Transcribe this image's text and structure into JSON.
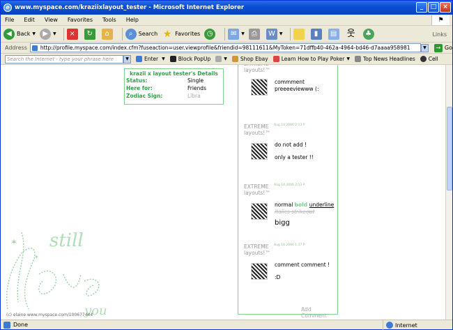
{
  "window": {
    "title": "www.myspace.com/kraziixlayout_tester - Microsoft Internet Explorer"
  },
  "menu": [
    "File",
    "Edit",
    "View",
    "Favorites",
    "Tools",
    "Help"
  ],
  "toolbar": {
    "back": "Back",
    "search": "Search",
    "favorites": "Favorites",
    "links": "Links"
  },
  "address": {
    "label": "Address",
    "url": "http://profile.myspace.com/index.cfm?fuseaction=user.viewprofile&friendid=98111611&MyToken=71dffb40-462a-4964-bd46-d7aaaa958981",
    "go": "Go"
  },
  "searchbar": {
    "placeholder": "Search the Internet - type your phrase here",
    "enter": "Enter",
    "block": "Block PopUp",
    "shop": "Shop Ebay",
    "poker": "Learn How to Play Poker",
    "news": "Top News Headlines",
    "cell": "Cell"
  },
  "details": {
    "heading": "krazii x layout tester's Details",
    "rows": [
      {
        "k": "Status:",
        "v": "Single"
      },
      {
        "k": "Here for:",
        "v": "Friends"
      },
      {
        "k": "Zodiac Sign:",
        "v": "Libra"
      }
    ]
  },
  "comments": [
    {
      "who": "EXTREME layouts!™",
      "date": "",
      "lines": [
        "commment",
        "preeeeviewww (:"
      ]
    },
    {
      "who": "EXTREME layouts!™",
      "date": "Aug 14 2006 2:13 P",
      "lines": [
        "do not add !",
        "only a tester !!"
      ]
    },
    {
      "who": "EXTREME layouts!™",
      "date": "Aug 14 2006 2:13 P",
      "lines": [
        "normal bold underline",
        "italics strikeout",
        "bigg"
      ]
    },
    {
      "who": "EXTREME layouts!™",
      "date": "Aug 14 2006 1:17 P",
      "lines": [
        "comment comment !",
        ":D"
      ]
    }
  ],
  "add_comment": "Add Comment",
  "art": {
    "text1": "still",
    "text2": "love",
    "text3": "you",
    "credit": "(c) elaine www.myspace.com/100677444"
  },
  "status": {
    "left": "Done",
    "zone": "Internet"
  }
}
